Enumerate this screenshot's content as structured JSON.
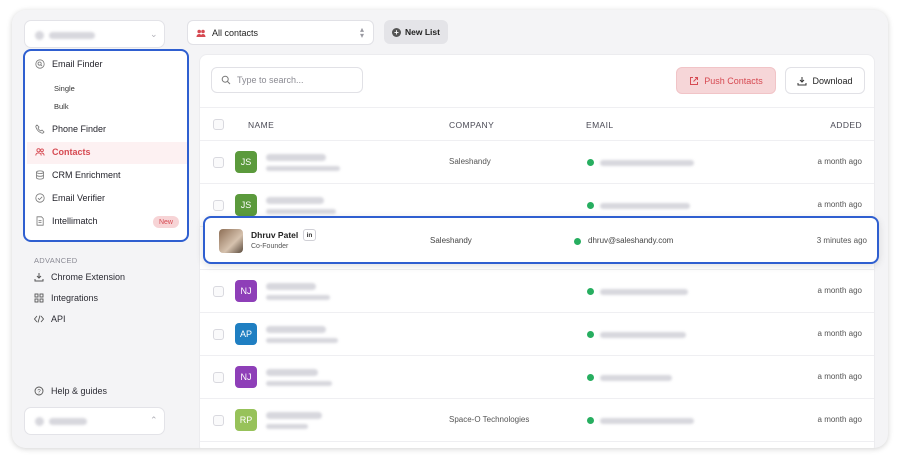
{
  "sidebar": {
    "advanced_label": "ADVANCED",
    "advanced_items": [
      {
        "label": "Chrome Extension",
        "icon": "download-icon"
      },
      {
        "label": "Integrations",
        "icon": "grid-icon"
      },
      {
        "label": "API",
        "icon": "code-icon"
      }
    ],
    "help_label": "Help & guides"
  },
  "menu": {
    "email_finder": "Email Finder",
    "sub_single": "Single",
    "sub_bulk": "Bulk",
    "phone_finder": "Phone Finder",
    "contacts": "Contacts",
    "crm_enrichment": "CRM Enrichment",
    "email_verifier": "Email Verifier",
    "intellimatch": "Intellimatch",
    "new_badge": "New"
  },
  "toolbar": {
    "list_select": "All contacts",
    "new_list": "New List",
    "search_placeholder": "Type to search...",
    "push_contacts": "Push Contacts",
    "download": "Download"
  },
  "table": {
    "headers": {
      "name": "NAME",
      "company": "COMPANY",
      "email": "EMAIL",
      "added": "ADDED"
    },
    "rows": [
      {
        "initials": "JS",
        "color": "#5b9a3c",
        "company": "Saleshandy",
        "added": "a month ago"
      },
      {
        "initials": "JS",
        "color": "#5b9a3c",
        "company": "",
        "added": "a month ago"
      },
      {
        "initials": "NJ",
        "color": "#8e3fb8",
        "company": "",
        "added": "a month ago"
      },
      {
        "initials": "AP",
        "color": "#1f7fc2",
        "company": "",
        "added": "a month ago"
      },
      {
        "initials": "NJ",
        "color": "#8e3fb8",
        "company": "",
        "added": "a month ago"
      },
      {
        "initials": "RP",
        "color": "#97c25a",
        "company": "Space-O Technologies",
        "added": "a month ago"
      }
    ]
  },
  "highlight": {
    "name": "Dhruv Patel",
    "linkedin": "in",
    "role": "Co-Founder",
    "company": "Saleshandy",
    "email": "dhruv@saleshandy.com",
    "added": "3 minutes ago"
  },
  "colors": {
    "accent": "#2f5fd0",
    "brand_red": "#d64a52",
    "verified": "#27ae60"
  }
}
